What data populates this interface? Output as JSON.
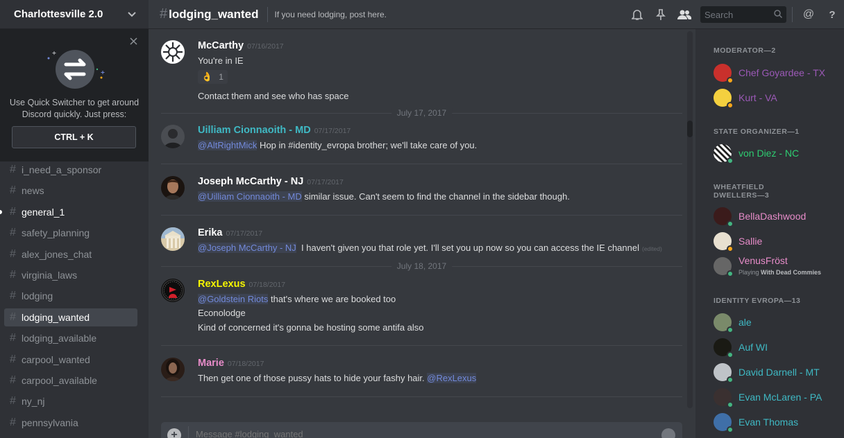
{
  "server": {
    "name": "Charlottesville 2.0"
  },
  "quick_switcher": {
    "text_line1": "Use Quick Switcher to get around",
    "text_line2": "Discord quickly. Just press:",
    "shortcut": "CTRL + K"
  },
  "channels": [
    {
      "name": "i_need_a_sponsor",
      "state": "normal"
    },
    {
      "name": "news",
      "state": "normal"
    },
    {
      "name": "general_1",
      "state": "unread"
    },
    {
      "name": "safety_planning",
      "state": "normal"
    },
    {
      "name": "alex_jones_chat",
      "state": "normal"
    },
    {
      "name": "virginia_laws",
      "state": "normal"
    },
    {
      "name": "lodging",
      "state": "normal"
    },
    {
      "name": "lodging_wanted",
      "state": "active"
    },
    {
      "name": "lodging_available",
      "state": "normal"
    },
    {
      "name": "carpool_wanted",
      "state": "normal"
    },
    {
      "name": "carpool_available",
      "state": "normal"
    },
    {
      "name": "ny_nj",
      "state": "normal"
    },
    {
      "name": "pennsylvania",
      "state": "normal"
    }
  ],
  "header": {
    "channel_name": "lodging_wanted",
    "topic": "If you need lodging, post here.",
    "search_placeholder": "Search"
  },
  "messages": [
    {
      "author": "McCarthy",
      "color": "#ffffff",
      "timestamp": "07/16/2017",
      "lines": [
        "You're in IE"
      ],
      "reaction": {
        "emoji": "👌",
        "count": "1"
      },
      "after_reaction": "Contact them and see who has space"
    },
    {
      "author": "Uilliam Cionnaoith - MD",
      "color": "#3fb9c4",
      "timestamp": "07/17/2017",
      "mention": "@AltRightMick",
      "text": " Hop in #identity_evropa brother; we'll take care of you."
    },
    {
      "author": "Joseph McCarthy - NJ",
      "color": "#ffffff",
      "timestamp": "07/17/2017",
      "mention": "@Uilliam Cionnaoith - MD",
      "text": " similar issue. Can't seem to find the channel in the sidebar though."
    },
    {
      "author": "Erika",
      "color": "#ffffff",
      "timestamp": "07/17/2017",
      "mention": "@Joseph McCarthy - NJ",
      "text": "  I haven't given you that role yet. I'll set you up now so you can access the IE channel",
      "edited": "(edited)"
    },
    {
      "author": "RexLexus",
      "color": "#f5f500",
      "timestamp": "07/18/2017",
      "mention": "@Goldstein Riots",
      "text": " that's where we are booked too",
      "lines": [
        "Econolodge",
        "Kind of concerned it's gonna be hosting some antifa also"
      ]
    },
    {
      "author": "Marie",
      "color": "#e78cc9",
      "timestamp": "07/18/2017",
      "text": "Then get one of those pussy hats to hide your fashy hair. ",
      "mention": "@RexLexus"
    }
  ],
  "day_separators": [
    "July 17, 2017",
    "July 18, 2017"
  ],
  "composer": {
    "placeholder": "Message #lodging_wanted"
  },
  "member_groups": [
    {
      "title": "MODERATOR—2",
      "members": [
        {
          "name": "Chef Goyardee - TX",
          "color": "#9b59b6",
          "status": "idle"
        },
        {
          "name": "Kurt - VA",
          "color": "#9b59b6",
          "status": "idle"
        }
      ]
    },
    {
      "title": "STATE ORGANIZER—1",
      "members": [
        {
          "name": "von Diez - NC",
          "color": "#2ecc71",
          "status": "online"
        }
      ]
    },
    {
      "title_line1": "WHEATFIELD",
      "title_line2": "DWELLERS—3",
      "members": [
        {
          "name": "BellaDashwood",
          "color": "#e78cc9",
          "status": "online"
        },
        {
          "name": "Sallie",
          "color": "#e78cc9",
          "status": "idle"
        },
        {
          "name": "VenusFröst",
          "color": "#e78cc9",
          "status": "online",
          "playing_prefix": "Playing ",
          "playing_game": "With Dead Commies"
        }
      ]
    },
    {
      "title": "IDENTITY EVROPA—13",
      "members": [
        {
          "name": "ale",
          "color": "#3fb9c4",
          "status": "online"
        },
        {
          "name": "Auf WI",
          "color": "#3fb9c4",
          "status": "online"
        },
        {
          "name": "David Darnell - MT",
          "color": "#3fb9c4",
          "status": "online"
        },
        {
          "name": "Evan McLaren - PA",
          "color": "#3fb9c4",
          "status": "online"
        },
        {
          "name": "Evan Thomas",
          "color": "#3fb9c4",
          "status": "online"
        }
      ]
    }
  ],
  "colors": {
    "online": "#43b581",
    "idle": "#faa61a",
    "mention": "#7289da"
  }
}
